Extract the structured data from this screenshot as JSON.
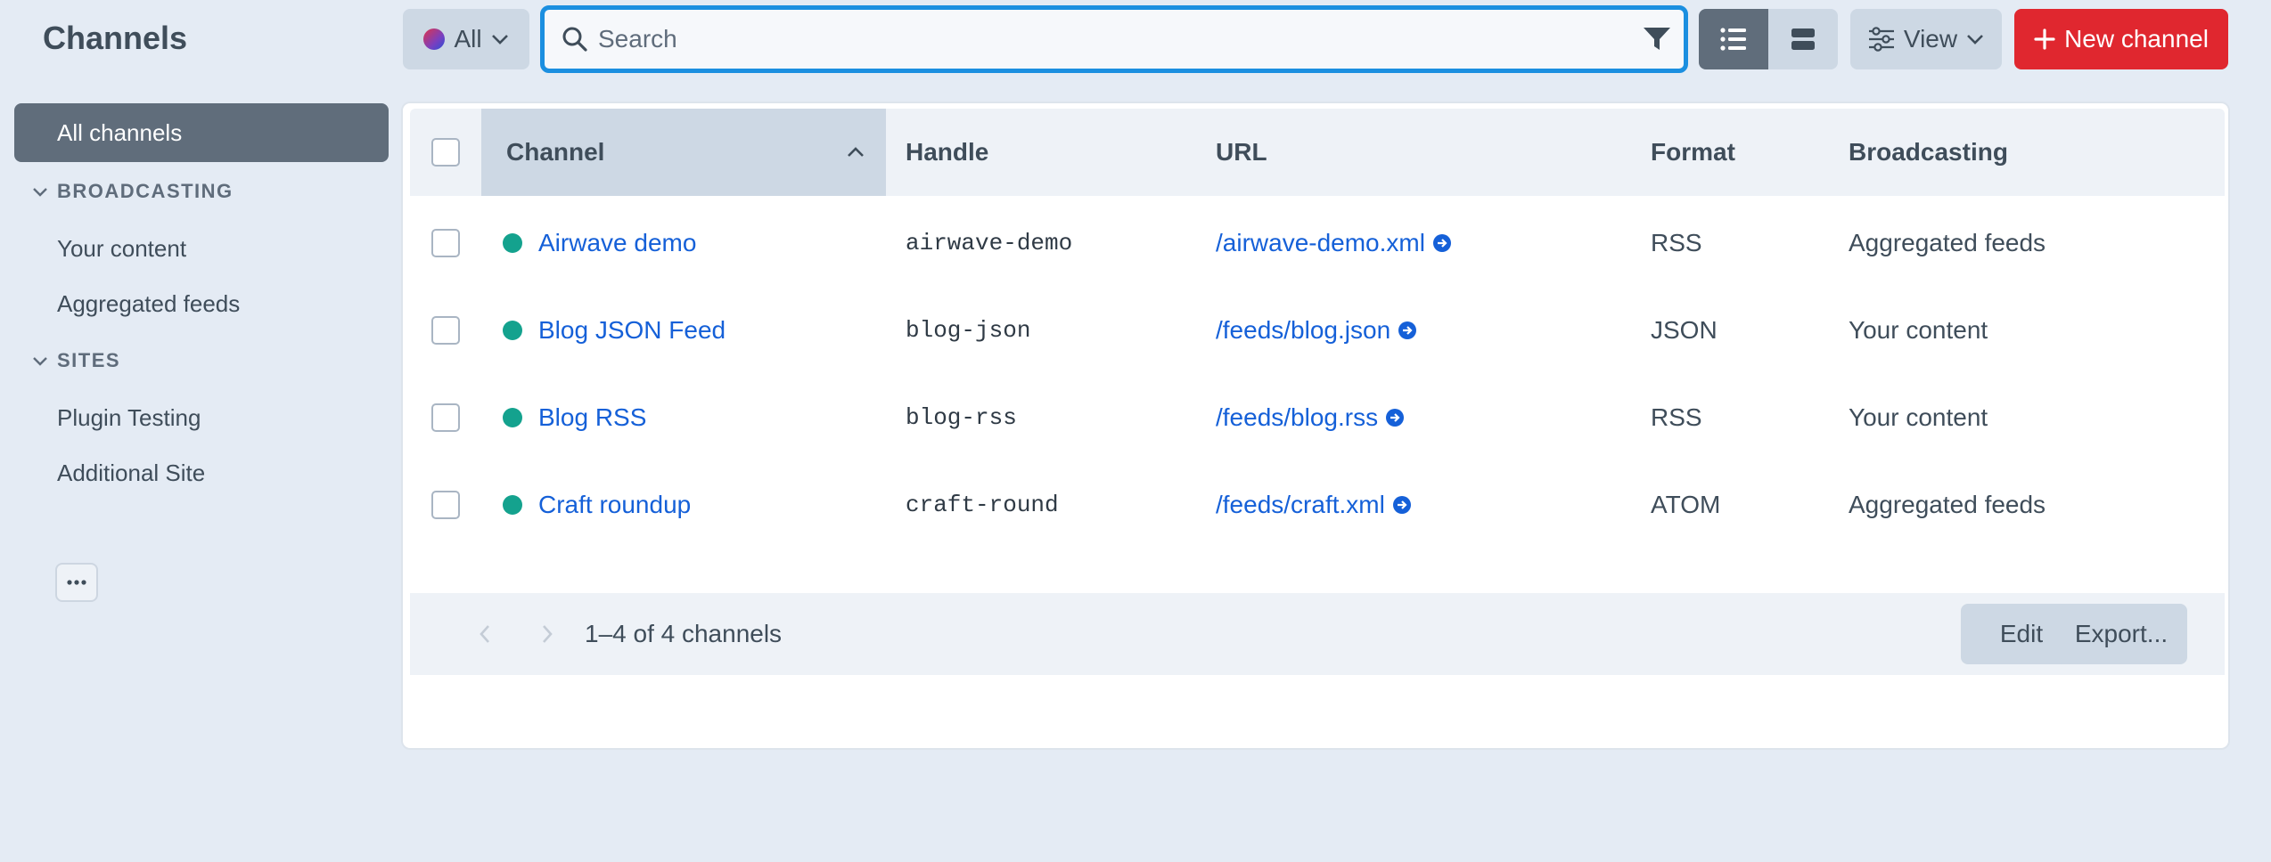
{
  "page": {
    "title": "Channels"
  },
  "sidebar": {
    "all_label": "All channels",
    "groups": [
      {
        "heading": "BROADCASTING",
        "items": [
          "Your content",
          "Aggregated feeds"
        ]
      },
      {
        "heading": "SITES",
        "items": [
          "Plugin Testing",
          "Additional Site"
        ]
      }
    ]
  },
  "toolbar": {
    "site_label": "All",
    "search_placeholder": "Search",
    "view_label": "View",
    "new_label": "New channel"
  },
  "table": {
    "columns": [
      "Channel",
      "Handle",
      "URL",
      "Format",
      "Broadcasting"
    ],
    "rows": [
      {
        "name": "Airwave demo",
        "handle": "airwave-demo",
        "url": "/airwave-demo.xml",
        "format": "RSS",
        "broadcasting": "Aggregated feeds",
        "status": "enabled"
      },
      {
        "name": "Blog JSON Feed",
        "handle": "blog-json",
        "url": "/feeds/blog.json",
        "format": "JSON",
        "broadcasting": "Your content",
        "status": "enabled"
      },
      {
        "name": "Blog RSS",
        "handle": "blog-rss",
        "url": "/feeds/blog.rss",
        "format": "RSS",
        "broadcasting": "Your content",
        "status": "enabled"
      },
      {
        "name": "Craft roundup",
        "handle": "craft-round",
        "url": "/feeds/craft.xml",
        "format": "ATOM",
        "broadcasting": "Aggregated feeds",
        "status": "enabled"
      }
    ]
  },
  "footer": {
    "count_text": "1–4 of 4 channels",
    "edit_label": "Edit",
    "export_label": "Export..."
  },
  "colors": {
    "accent": "#1b8fe0",
    "danger": "#e0272f",
    "status_enabled": "#14a28e",
    "link": "#1560d8"
  },
  "icons": {
    "search": "search-icon",
    "filter": "filter-icon",
    "list_view": "list-view-icon",
    "structure_view": "structure-view-icon",
    "view_settings": "sliders-icon",
    "add": "plus-icon",
    "sort": "chevron-up-icon",
    "go": "arrow-circle-right-icon"
  }
}
